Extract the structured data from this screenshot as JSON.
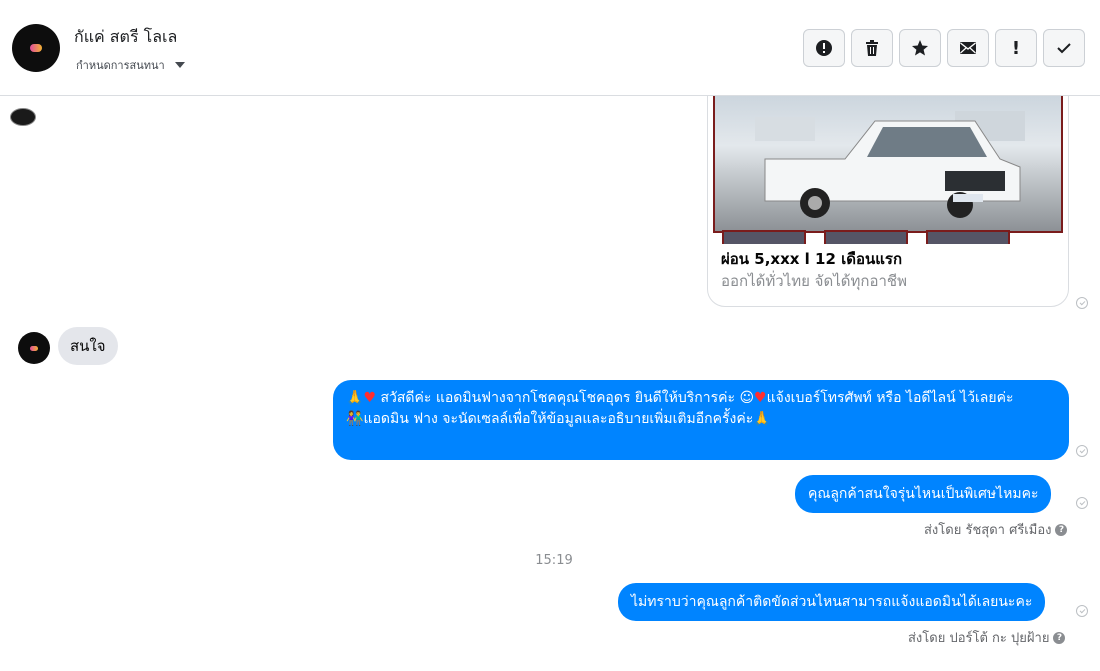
{
  "header": {
    "contact_name": "กัแค่ สตรี โลเล",
    "assign_label": "กำหนดการสนทนา",
    "actions": [
      {
        "name": "mark-spam-button",
        "icon": "exclamation-circle-icon"
      },
      {
        "name": "delete-button",
        "icon": "trash-icon"
      },
      {
        "name": "star-button",
        "icon": "star-icon"
      },
      {
        "name": "mark-unread-button",
        "icon": "envelope-icon"
      },
      {
        "name": "follow-up-button",
        "icon": "exclamation-icon",
        "glyph": "!"
      },
      {
        "name": "mark-done-button",
        "icon": "check-icon"
      }
    ]
  },
  "thread": {
    "card": {
      "title": "ผ่อน 5,xxx l 12 เดือนแรก",
      "subtitle": "ออกได้ทั่วไทย จัดได้ทุกอาชีพ"
    },
    "incoming": {
      "text": "สนใจ"
    },
    "outgoing": [
      {
        "line1": "สวัสดีค่ะ แอดมินฟางจากโชคคุณโชคอุดร ยินดีให้บริการค่ะ",
        "line1b": "แจ้งเบอร์โทรศัพท์ หรือ ไอดีไลน์  ไว้เลยค่ะ",
        "line2": "แอดมิน ฟาง จะนัดเซลล์เพื่อให้ข้อมูลและอธิบายเพิ่มเติมอีกครั้งค่ะ"
      },
      {
        "text": "คุณลูกค้าสนใจรุ่นไหนเป็นพิเศษไหมคะ"
      },
      {
        "text": "ไม่ทราบว่าคุณลูกค้าติดขัดส่วนไหนสามารถแจ้งแอดมินได้เลยนะคะ"
      }
    ],
    "sent_by_1": "ส่งโดย รัชสุดา ศรีเมือง",
    "timestamp": "15:19",
    "sent_by_2": "ส่งโดย ปอร์โต้ กะ ปุยฝ้าย",
    "help_glyph": "?"
  },
  "colors": {
    "outgoing_bubble": "#0084ff",
    "incoming_bubble": "#e4e6eb",
    "header_border": "#dadde1"
  }
}
